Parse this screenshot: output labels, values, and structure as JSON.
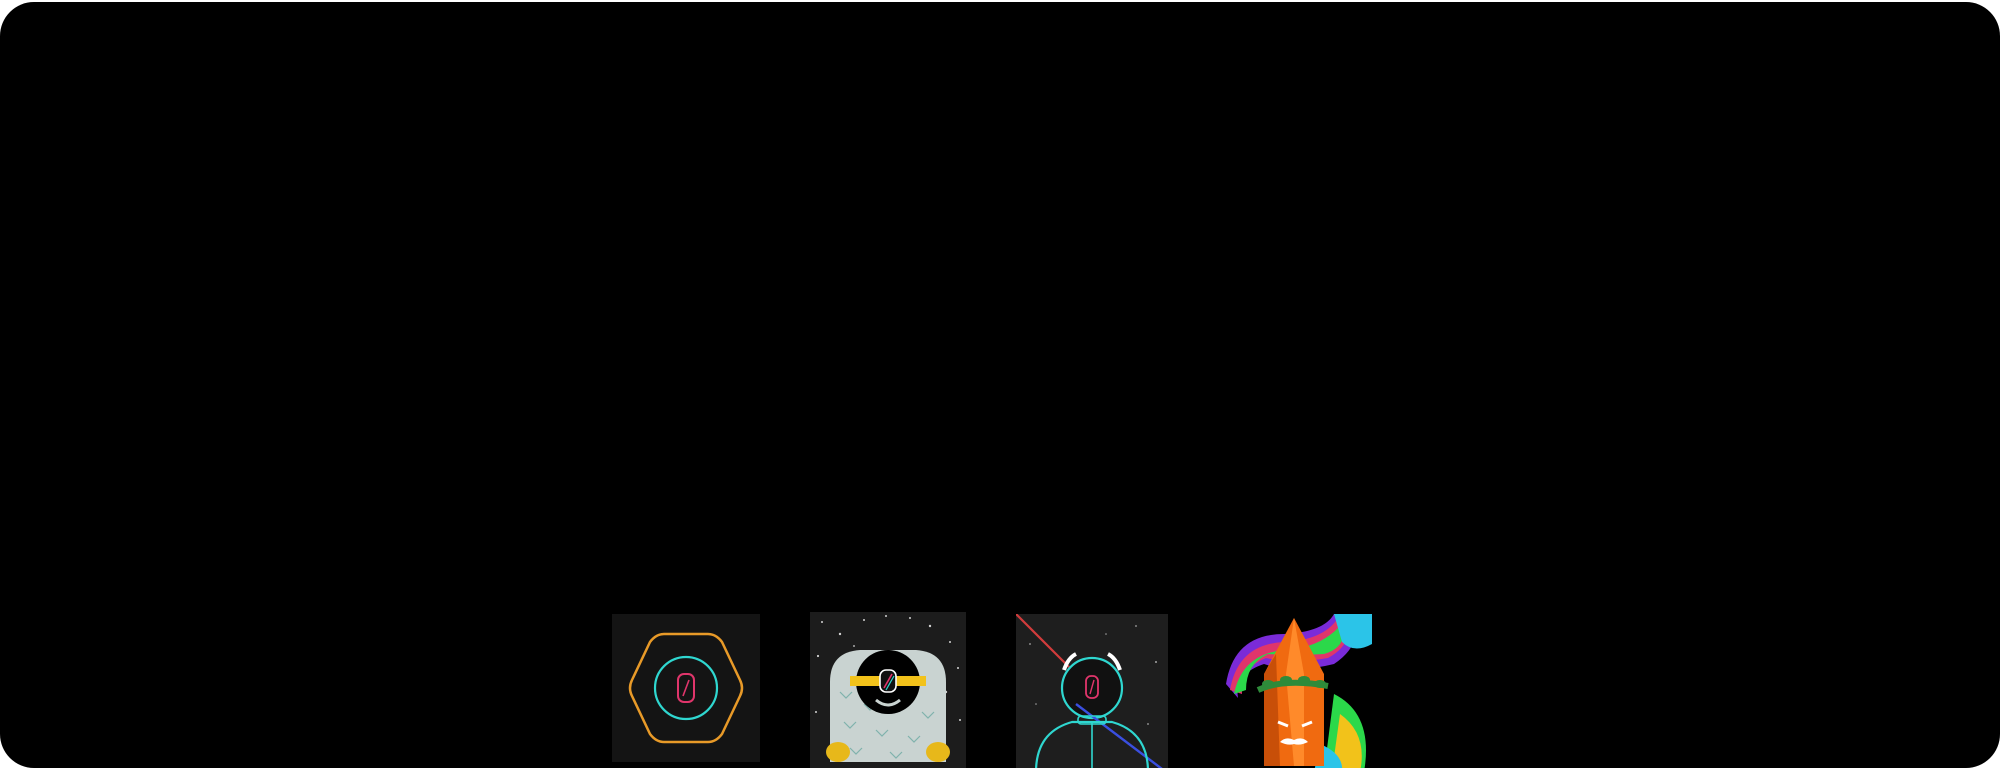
{
  "tiles": [
    {
      "name": "hexagon-logo",
      "background": "#141414",
      "glyph": "0"
    },
    {
      "name": "yeti-avatar",
      "background": "#1c1c1c",
      "glyph": "0"
    },
    {
      "name": "astronaut-avatar",
      "background": "#1e1e1e",
      "glyph": "0"
    },
    {
      "name": "crystal-character",
      "background": "#000000"
    }
  ],
  "colors": {
    "frame": "#000000",
    "orange": "#e89a28",
    "cyan": "#2fd7d0",
    "pink": "#e0356b",
    "yellow": "#f2c21a"
  }
}
